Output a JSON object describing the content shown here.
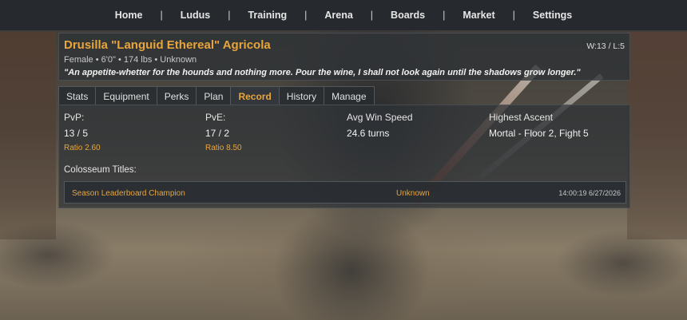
{
  "nav": {
    "items": [
      "Home",
      "Ludus",
      "Training",
      "Arena",
      "Boards",
      "Market",
      "Settings"
    ],
    "separator": "|"
  },
  "gladiator": {
    "name": "Drusilla \"Languid Ethereal\" Agricola",
    "meta": "Female • 6'0\" • 174 lbs • Unknown",
    "quote": "\"An appetite-whetter for the hounds and nothing more. Pour the wine, I shall not look again until the shadows grow longer.\"",
    "wl": "W:13 / L:5"
  },
  "tabs": {
    "items": [
      "Stats",
      "Equipment",
      "Perks",
      "Plan",
      "Record",
      "History",
      "Manage"
    ],
    "active": "Record"
  },
  "record": {
    "pvp": {
      "label": "PvP:",
      "value": "13 / 5",
      "ratio": "Ratio 2.60"
    },
    "pve": {
      "label": "PvE:",
      "value": "17 / 2",
      "ratio": "Ratio 8.50"
    },
    "speed": {
      "label": "Avg Win Speed",
      "value": "24.6 turns"
    },
    "ascent": {
      "label": "Highest Ascent",
      "value": "Mortal - Floor 2, Fight 5"
    },
    "titles_label": "Colosseum Titles:",
    "titles": [
      {
        "name": "Season Leaderboard Champion",
        "holder": "Unknown",
        "time": "14:00:19 6/27/2026"
      }
    ]
  },
  "colors": {
    "accent": "#e8a53a",
    "nav_bg": "#262a2e",
    "panel_bg": "#2e3236"
  }
}
